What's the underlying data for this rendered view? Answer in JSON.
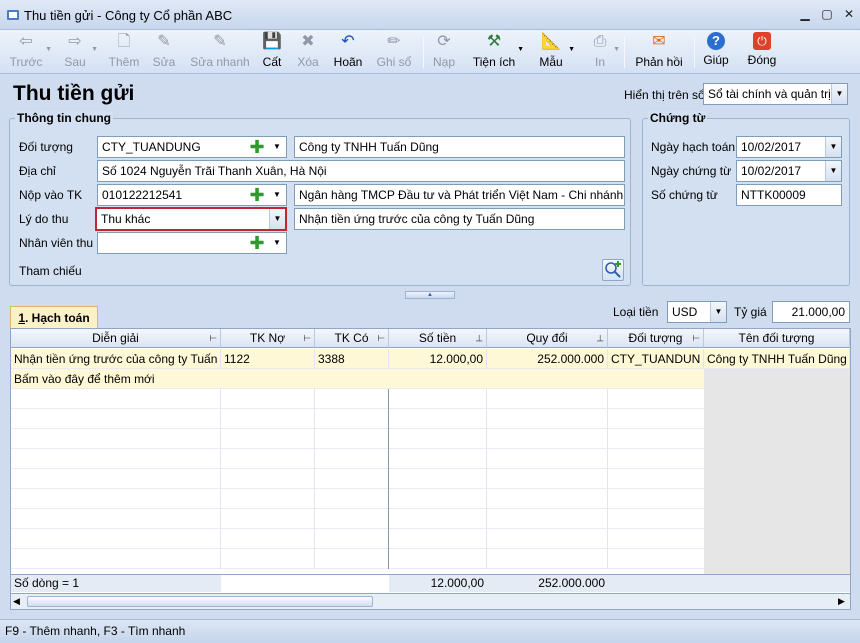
{
  "window": {
    "title": "Thu tiền gửi - Công ty Cổ phần ABC",
    "minimize": "▁",
    "maximize": "▢",
    "close": "✕"
  },
  "toolbar": [
    {
      "key": "truoc",
      "label": "Trước",
      "icon": "arrow-left-icon",
      "glyph": "⇦",
      "enabled": false,
      "dropdown": true
    },
    {
      "key": "sau",
      "label": "Sau",
      "icon": "arrow-right-icon",
      "glyph": "⇨",
      "enabled": false,
      "dropdown": true
    },
    {
      "key": "them",
      "label": "Thêm",
      "icon": "new-document-icon",
      "glyph": "🗋",
      "enabled": false
    },
    {
      "key": "sua",
      "label": "Sửa",
      "icon": "edit-document-icon",
      "glyph": "✎",
      "enabled": false
    },
    {
      "key": "suanhanh",
      "label": "Sửa nhanh",
      "icon": "quick-edit-icon",
      "glyph": "✎",
      "enabled": false
    },
    {
      "key": "cat",
      "label": "Cất",
      "icon": "save-icon",
      "glyph": "💾",
      "enabled": true
    },
    {
      "key": "xoa",
      "label": "Xóa",
      "icon": "delete-icon",
      "glyph": "✖",
      "enabled": false
    },
    {
      "key": "hoan",
      "label": "Hoãn",
      "icon": "undo-icon",
      "glyph": "↶",
      "enabled": true
    },
    {
      "key": "ghiso",
      "label": "Ghi sổ",
      "icon": "pencil-icon",
      "glyph": "✏",
      "enabled": false
    },
    {
      "key": "nap",
      "label": "Nạp",
      "icon": "reload-icon",
      "glyph": "⟳",
      "enabled": false
    },
    {
      "key": "tienich",
      "label": "Tiện ích",
      "icon": "tools-icon",
      "glyph": "⚒",
      "enabled": true,
      "dropdown": true
    },
    {
      "key": "mau",
      "label": "Mẫu",
      "icon": "template-icon",
      "glyph": "📐",
      "enabled": true,
      "dropdown": true
    },
    {
      "key": "in",
      "label": "In",
      "icon": "printer-icon",
      "glyph": "⎙",
      "enabled": false,
      "dropdown": true
    },
    {
      "key": "phanhoi",
      "label": "Phản hồi",
      "icon": "envelope-icon",
      "glyph": "✉",
      "enabled": true
    },
    {
      "key": "giup",
      "label": "Giúp",
      "icon": "help-icon",
      "glyph": "?",
      "enabled": true
    },
    {
      "key": "dong",
      "label": "Đóng",
      "icon": "power-icon",
      "glyph": "⏻",
      "enabled": true
    }
  ],
  "form": {
    "title": "Thu tiền gửi",
    "view_label": "Hiển thị trên sổ",
    "view_value": "Sổ tài chính và quản trị"
  },
  "general": {
    "legend": "Thông tin chung",
    "doi_tuong_label": "Đối tượng",
    "doi_tuong_code": "CTY_TUANDUNG",
    "doi_tuong_name": "Công ty TNHH Tuấn Dũng",
    "dia_chi_label": "Địa chỉ",
    "dia_chi": "Số 1024 Nguyễn Trãi Thanh Xuân, Hà Nội",
    "nop_vao_label": "Nộp vào TK",
    "nop_vao_tk": "010122212541",
    "ngan_hang": "Ngân hàng TMCP Đầu tư và Phát triển Việt Nam - Chi nhánh Th",
    "ly_do_label": "Lý do thu",
    "ly_do": "Thu khác",
    "dien_giai": "Nhận tiền ứng trước của công ty Tuấn Dũng",
    "nhan_vien_label": "Nhân viên thu",
    "nhan_vien": "",
    "tham_chieu_label": "Tham chiếu"
  },
  "voucher": {
    "legend": "Chứng từ",
    "ngay_hach_toan_label": "Ngày hạch toán",
    "ngay_hach_toan": "10/02/2017",
    "ngay_chung_tu_label": "Ngày chứng từ",
    "ngay_chung_tu": "10/02/2017",
    "so_chung_tu_label": "Số chứng từ",
    "so_chung_tu": "NTTK00009"
  },
  "currency": {
    "label": "Loại tiền",
    "value": "USD",
    "rate_label": "Tỷ giá",
    "rate": "21.000,00"
  },
  "tab": {
    "number": "1",
    "label": ". Hạch toán"
  },
  "grid": {
    "columns": [
      "Diễn giải",
      "TK Nợ",
      "TK Có",
      "Số tiền",
      "Quy đổi",
      "Đối tượng",
      "Tên đối tượng"
    ],
    "rows": [
      [
        "Nhận tiền ứng trước của công ty Tuấn D",
        "1122",
        "3388",
        "12.000,00",
        "252.000.000",
        "CTY_TUANDUN",
        "Công ty TNHH Tuấn Dũng"
      ]
    ],
    "add_row_hint": "Bấm vào đây để thêm mới",
    "footer": {
      "count": "Số dòng = 1",
      "so_tien": "12.000,00",
      "quy_doi": "252.000.000"
    }
  },
  "status": "F9 - Thêm nhanh, F3 - Tìm nhanh",
  "colors": {
    "highlight_row": "#fff8d6",
    "selected_border": "#c0262c",
    "panel": "#d3e0f2"
  }
}
